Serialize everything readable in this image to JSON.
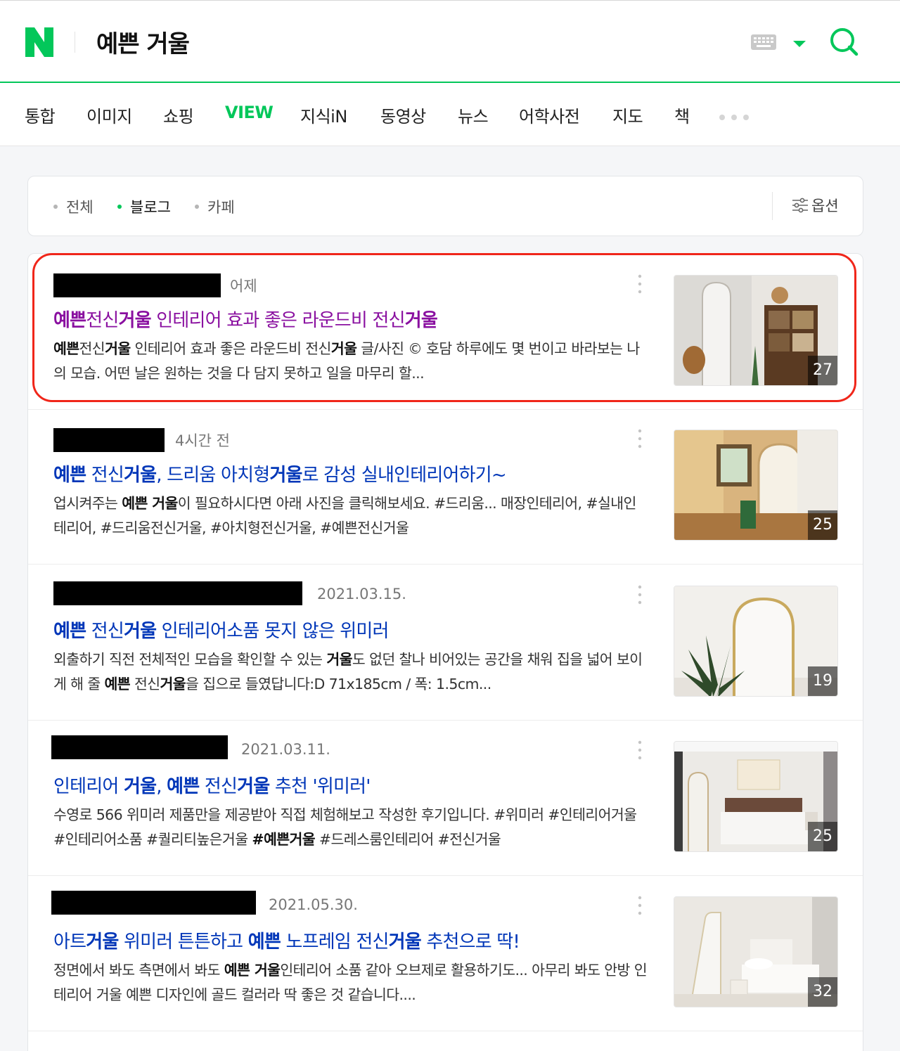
{
  "header": {
    "query": "예쁜 거울",
    "logo_letter": "N",
    "icons": [
      "keyboard-icon",
      "caret-down-icon",
      "search-icon"
    ],
    "brand_color": "#03c75a"
  },
  "tabs": [
    {
      "label": "통합",
      "active": false
    },
    {
      "label": "이미지",
      "active": false
    },
    {
      "label": "쇼핑",
      "active": false
    },
    {
      "label": "VIEW",
      "active": true
    },
    {
      "label": "지식iN",
      "active": false
    },
    {
      "label": "동영상",
      "active": false
    },
    {
      "label": "뉴스",
      "active": false
    },
    {
      "label": "어학사전",
      "active": false
    },
    {
      "label": "지도",
      "active": false
    },
    {
      "label": "책",
      "active": false
    }
  ],
  "filters": {
    "items": [
      {
        "label": "전체",
        "active": false
      },
      {
        "label": "블로그",
        "active": true
      },
      {
        "label": "카페",
        "active": false
      }
    ],
    "options_label": "옵션"
  },
  "results": [
    {
      "date": "어제",
      "visited": true,
      "title": [
        [
          "예쁜",
          true
        ],
        [
          "전신",
          false
        ],
        [
          "거울",
          true
        ],
        [
          " 인테리어 효과 좋은 라운드비 전신",
          false
        ],
        [
          "거울",
          true
        ]
      ],
      "desc": [
        [
          "예쁜",
          true
        ],
        [
          "전신",
          false
        ],
        [
          "거울",
          true
        ],
        [
          " 인테리어 효과 좋은 라운드비 전신",
          false
        ],
        [
          "거울",
          true
        ],
        [
          " 글/사진 © 호담 하루에도 몇 번이고 바라보는 나의 모습. 어떤 날은 원하는 것을 다 담지 못하고 일을 마무리 할...",
          false
        ]
      ],
      "image_count": "27"
    },
    {
      "date": "4시간 전",
      "visited": false,
      "title": [
        [
          "예쁜",
          true
        ],
        [
          " 전신",
          false
        ],
        [
          "거울",
          true
        ],
        [
          ", 드리움 아치형",
          false
        ],
        [
          "거울",
          true
        ],
        [
          "로 감성 실내인테리어하기~",
          false
        ]
      ],
      "desc": [
        [
          "업시켜주는 ",
          false
        ],
        [
          "예쁜 거울",
          true
        ],
        [
          "이 필요하시다면 아래 사진을 클릭해보세요. #드리움... 매장인테리어, #실내인테리어, #드리움전신거울, #아치형전신거울, #예쁜전신거울",
          false
        ]
      ],
      "image_count": "25"
    },
    {
      "date": "2021.03.15.",
      "visited": false,
      "title": [
        [
          "예쁜",
          true
        ],
        [
          " 전신",
          false
        ],
        [
          "거울",
          true
        ],
        [
          " 인테리어소품 못지 않은 위미러",
          false
        ]
      ],
      "desc": [
        [
          "외출하기 직전 전체적인 모습을 확인할 수 있는 ",
          false
        ],
        [
          "거울",
          true
        ],
        [
          "도 없던 찰나 비어있는 공간을 채워 집을 넓어 보이게 해 줄 ",
          false
        ],
        [
          "예쁜",
          true
        ],
        [
          " 전신",
          false
        ],
        [
          "거울",
          true
        ],
        [
          "을 집으로 들였답니다:D 71x185cm / 폭: 1.5cm...",
          false
        ]
      ],
      "image_count": "19"
    },
    {
      "date": "2021.03.11.",
      "visited": false,
      "title": [
        [
          "인테리어 ",
          false
        ],
        [
          "거울",
          true
        ],
        [
          ", ",
          false
        ],
        [
          "예쁜",
          true
        ],
        [
          " 전신",
          false
        ],
        [
          "거울",
          true
        ],
        [
          " 추천 '위미러'",
          false
        ]
      ],
      "desc": [
        [
          "수영로 566 위미러 제품만을 제공받아 직접 체험해보고 작성한 후기입니다. #위미러 #인테리어거울 #인테리어소품 #퀄리티높은거울 ",
          false
        ],
        [
          "#예쁜거울",
          true
        ],
        [
          " #드레스룸인테리어 #전신거울",
          false
        ]
      ],
      "image_count": "25"
    },
    {
      "date": "2021.05.30.",
      "visited": false,
      "title": [
        [
          "아트",
          false
        ],
        [
          "거울",
          true
        ],
        [
          " 위미러 튼튼하고 ",
          false
        ],
        [
          "예쁜",
          true
        ],
        [
          " 노프레임 전신",
          false
        ],
        [
          "거울",
          true
        ],
        [
          " 추천으로 딱!",
          false
        ]
      ],
      "desc": [
        [
          "정면에서 봐도 측면에서 봐도 ",
          false
        ],
        [
          "예쁜 거울",
          true
        ],
        [
          "인테리어 소품 같아 오브제로 활용하기도... 아무리 봐도 안방 인테리어 거울 예쁜 디자인에 골드 컬러라 딱 좋은 것 같습니다....",
          false
        ]
      ],
      "image_count": "32"
    }
  ],
  "colors": {
    "link": "#0036b8",
    "visited_link": "#8a10a0",
    "highlight_border": "#f0261a"
  }
}
